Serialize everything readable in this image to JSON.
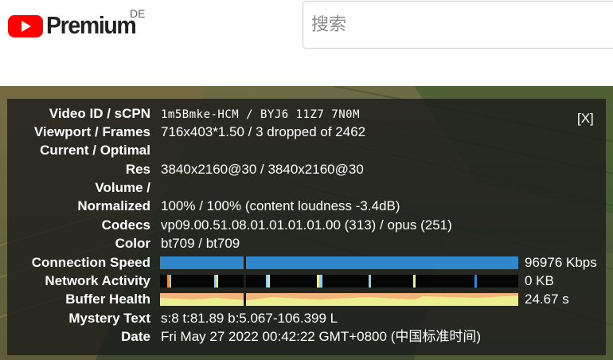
{
  "header": {
    "brand": "Premium",
    "country": "DE",
    "search_placeholder": "搜索"
  },
  "stats": {
    "close_label": "[X]",
    "video_id": {
      "label": "Video ID / sCPN",
      "value": "1m5Bmke-HCM / BYJ6 11Z7 7N0M"
    },
    "viewport": {
      "label": "Viewport / Frames",
      "value": "716x403*1.50 / 3 dropped of 2462"
    },
    "current_optimal": {
      "label": "Current / Optimal"
    },
    "res": {
      "label": "Res",
      "value": "3840x2160@30 / 3840x2160@30"
    },
    "volume": {
      "label": "Volume /"
    },
    "normalized": {
      "label": "Normalized",
      "value": "100% / 100% (content loudness -3.4dB)"
    },
    "codecs": {
      "label": "Codecs",
      "value": "vp09.00.51.08.01.01.01.01.00 (313) / opus (251)"
    },
    "color": {
      "label": "Color",
      "value": "bt709 / bt709"
    },
    "connection_speed": {
      "label": "Connection Speed",
      "value": "96976 Kbps",
      "color": "#2f86c8"
    },
    "network_activity": {
      "label": "Network Activity",
      "value": "0 KB",
      "color": "#050505"
    },
    "buffer_health": {
      "label": "Buffer Health",
      "value": "24.67 s",
      "color": "#ecef8f",
      "accent": "#f4b37a"
    },
    "mystery_text": {
      "label": "Mystery Text",
      "value": "s:8 t:81.89 b:5.067-106.399 L"
    },
    "date": {
      "label": "Date",
      "value": "Fri May 27 2022 00:42:22 GMT+0800 (中国标准时间)"
    }
  }
}
